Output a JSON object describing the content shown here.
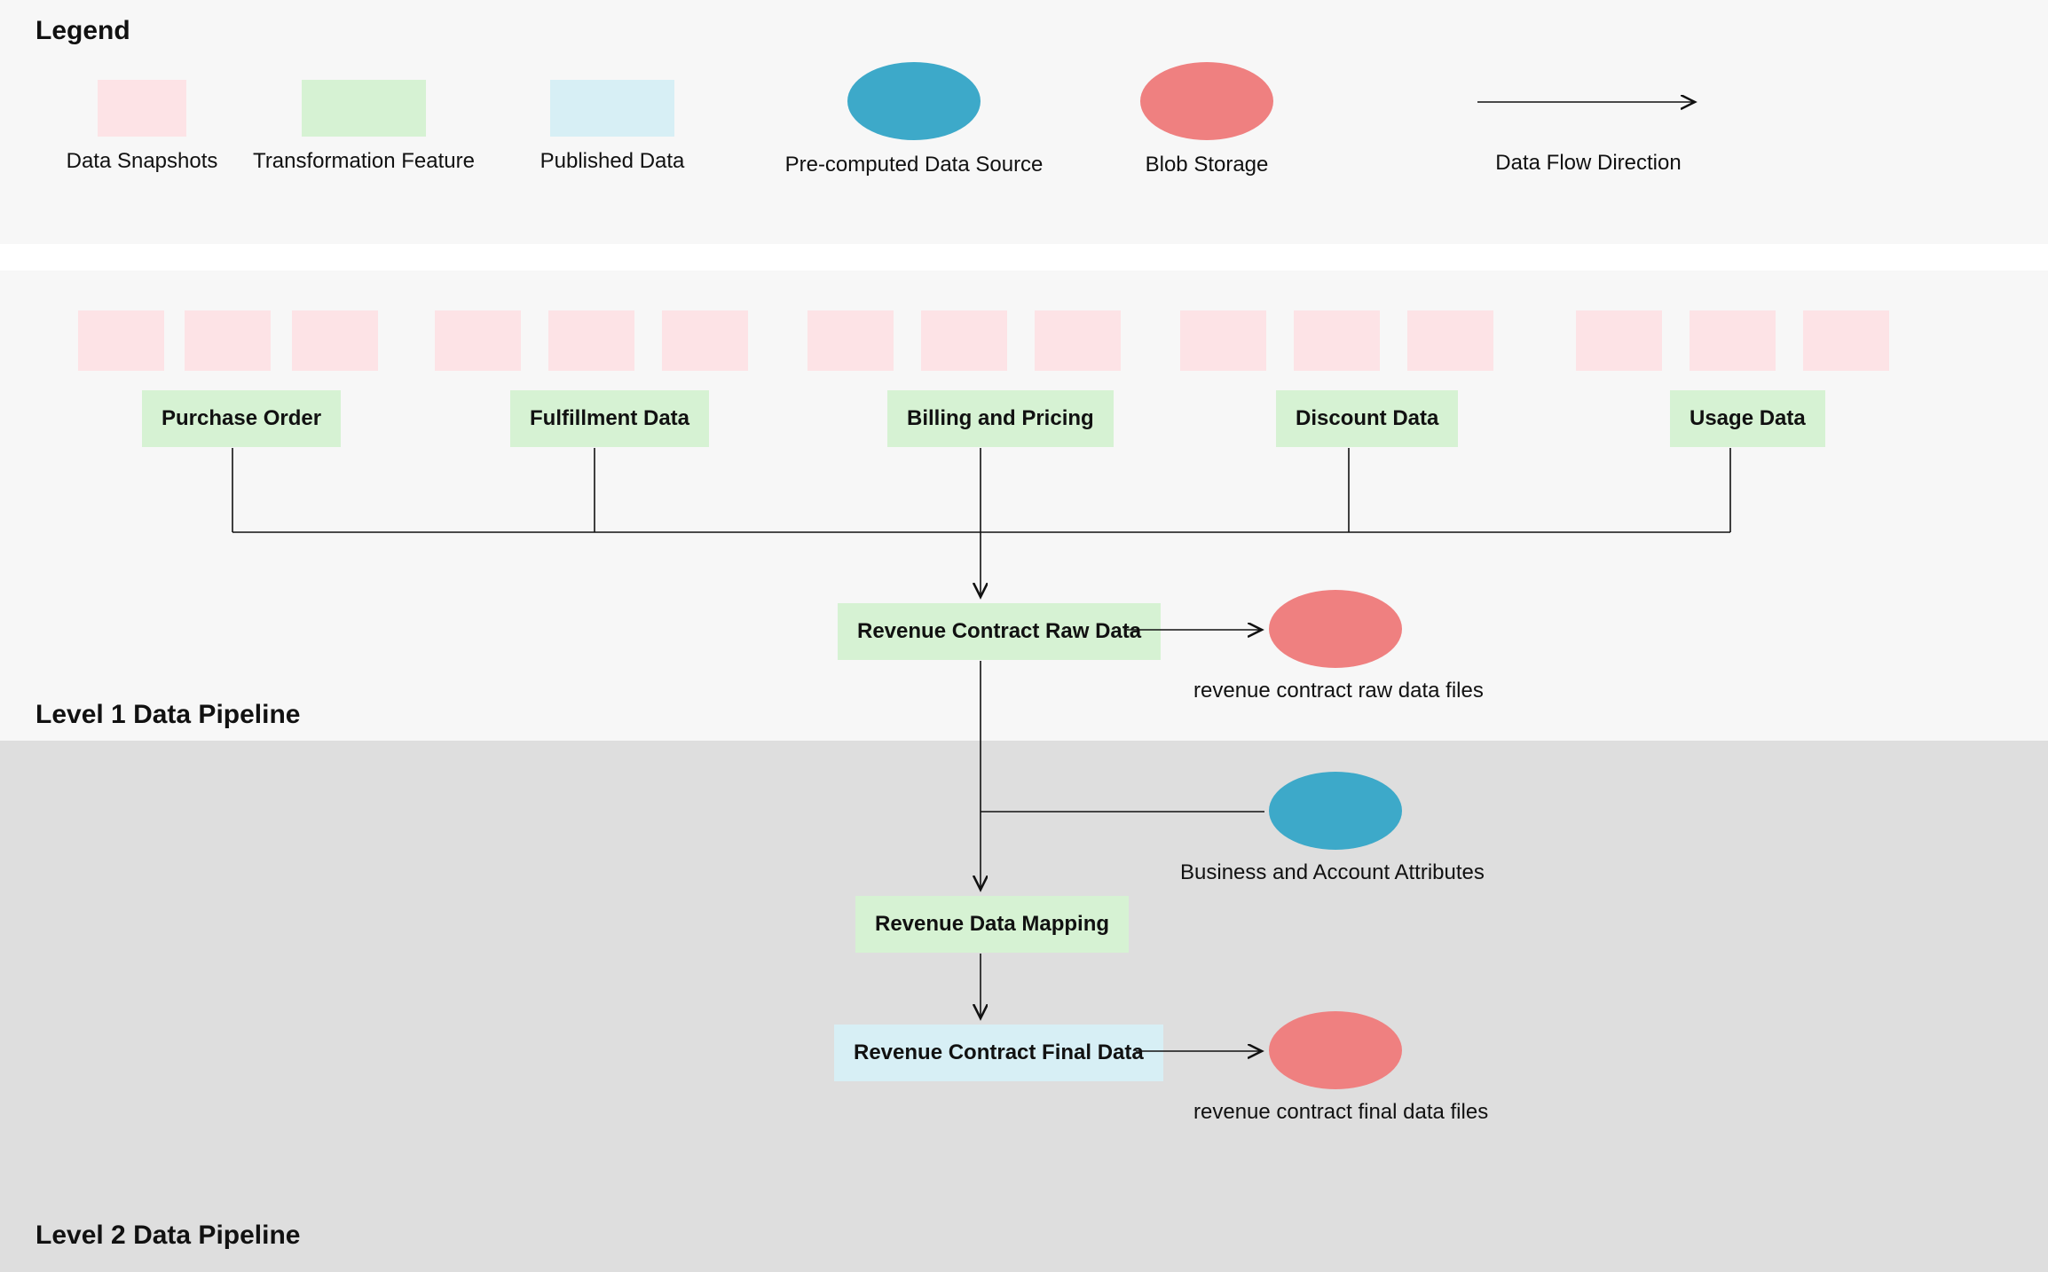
{
  "legend": {
    "title": "Legend",
    "items": {
      "snapshots": "Data Snapshots",
      "transformation": "Transformation Feature",
      "published": "Published Data",
      "precomputed": "Pre-computed Data Source",
      "blob": "Blob Storage",
      "flow": "Data Flow Direction"
    }
  },
  "level1": {
    "title": "Level 1 Data Pipeline",
    "features": {
      "purchase_order": "Purchase Order",
      "fulfillment_data": "Fulfillment Data",
      "billing_pricing": "Billing and Pricing",
      "discount_data": "Discount Data",
      "usage_data": "Usage Data",
      "revenue_raw": "Revenue Contract Raw Data"
    },
    "blob_caption": "revenue contract raw data files"
  },
  "level2": {
    "title": "Level 2 Data Pipeline",
    "precomputed_caption": "Business and Account Attributes",
    "features": {
      "revenue_mapping": "Revenue Data Mapping"
    },
    "published": {
      "revenue_final": "Revenue Contract Final Data"
    },
    "blob_caption": "revenue contract final data files"
  }
}
